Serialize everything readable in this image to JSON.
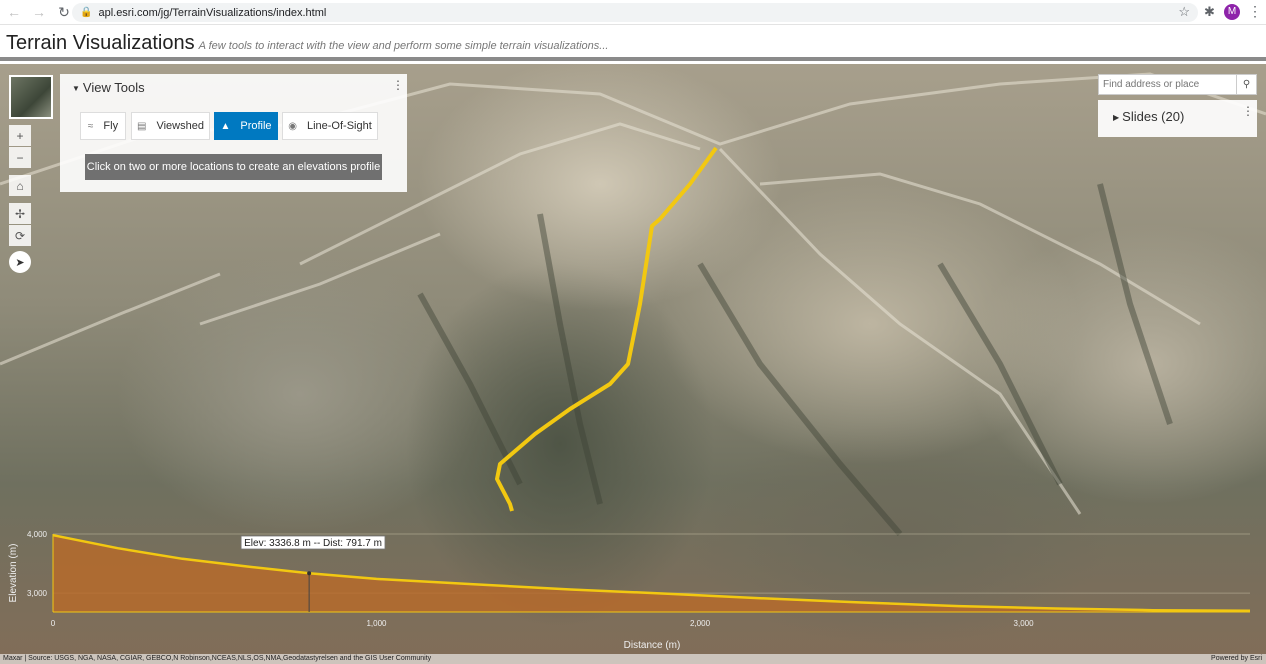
{
  "browser": {
    "url": "apl.esri.com/jg/TerrainVisualizations/index.html",
    "avatar_letter": "M"
  },
  "app": {
    "title": "Terrain Visualizations",
    "subtitle": "A few tools to interact with the view and perform some simple terrain visualizations..."
  },
  "view_tools": {
    "title": "View Tools",
    "tools": [
      {
        "label": "Fly",
        "icon": "fly-icon",
        "active": false
      },
      {
        "label": "Viewshed",
        "icon": "viewshed-icon",
        "active": false
      },
      {
        "label": "Profile",
        "icon": "profile-icon",
        "active": true
      },
      {
        "label": "Line-Of-Sight",
        "icon": "line-of-sight-icon",
        "active": false
      }
    ],
    "hint": "Click on two or more locations to create an elevations profile"
  },
  "search": {
    "placeholder": "Find address or place"
  },
  "slides": {
    "title": "Slides (20)"
  },
  "colors": {
    "active_tool": "#0079c1",
    "profile_line": "#f2c811",
    "profile_fill": "#b86a2a"
  },
  "chart_data": {
    "type": "area",
    "xlabel": "Distance (m)",
    "ylabel": "Elevation (m)",
    "xticks": [
      "0",
      "1,000",
      "2,000",
      "3,000"
    ],
    "yticks": [
      "4,000",
      "3,000"
    ],
    "xlim": [
      0,
      3700
    ],
    "ylim": [
      2680,
      4000
    ],
    "x": [
      0,
      200,
      400,
      600,
      791.7,
      1000,
      1300,
      1600,
      1900,
      2200,
      2500,
      2800,
      3100,
      3400,
      3700
    ],
    "y": [
      3980,
      3760,
      3580,
      3450,
      3336.8,
      3240,
      3150,
      3060,
      2990,
      2910,
      2840,
      2780,
      2740,
      2710,
      2700
    ],
    "tooltip": "Elev: 3336.8 m -- Dist: 791.7 m",
    "tooltip_x": 791.7
  },
  "attribution": {
    "text": "Maxar | Source: USGS, NGA, NASA, CGIAR, GEBCO,N Robinson,NCEAS,NLS,OS,NMA,Geodatastyrelsen and the GIS User Community",
    "powered": "Powered by Esri"
  }
}
